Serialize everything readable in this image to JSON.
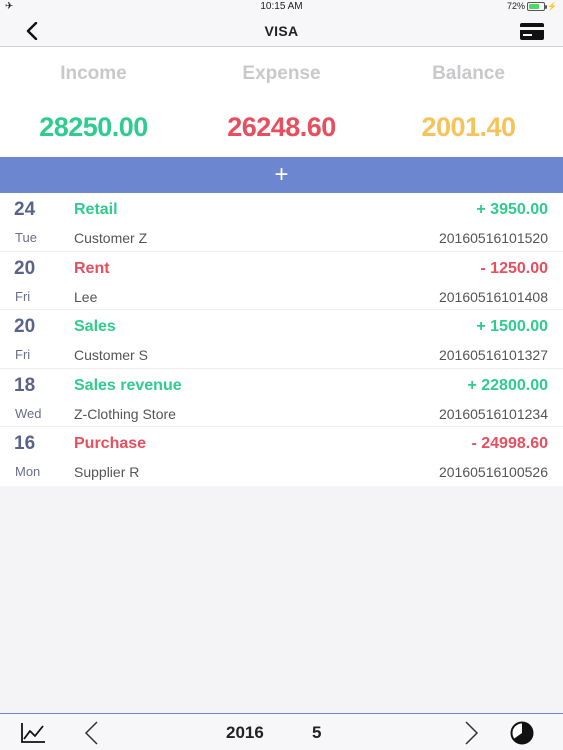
{
  "status_bar": {
    "time": "10:15 AM",
    "battery": "72%",
    "battery_level": 0.72
  },
  "nav": {
    "title": "VISA"
  },
  "summary": {
    "income_label": "Income",
    "expense_label": "Expense",
    "balance_label": "Balance",
    "income_value": "28250.00",
    "expense_value": "26248.60",
    "balance_value": "2001.40"
  },
  "add_bar": {
    "label": "+"
  },
  "transactions": [
    {
      "day": "24",
      "weekday": "Tue",
      "category": "Retail",
      "party": "Customer Z",
      "amount": "+ 3950.00",
      "id": "20160516101520",
      "type": "income"
    },
    {
      "day": "20",
      "weekday": "Fri",
      "category": "Rent",
      "party": "Lee",
      "amount": "- 1250.00",
      "id": "20160516101408",
      "type": "expense"
    },
    {
      "day": "20",
      "weekday": "Fri",
      "category": "Sales",
      "party": "Customer S",
      "amount": "+ 1500.00",
      "id": "20160516101327",
      "type": "income"
    },
    {
      "day": "18",
      "weekday": "Wed",
      "category": "Sales revenue",
      "party": "Z-Clothing Store",
      "amount": "+ 22800.00",
      "id": "20160516101234",
      "type": "income"
    },
    {
      "day": "16",
      "weekday": "Mon",
      "category": "Purchase",
      "party": "Supplier R",
      "amount": "- 24998.60",
      "id": "20160516100526",
      "type": "expense"
    }
  ],
  "toolbar": {
    "year": "2016",
    "month": "5"
  },
  "colors": {
    "income": "#2ecc8f",
    "expense": "#e84e5e",
    "balance": "#f5c35a",
    "accent": "#6d86d0"
  },
  "icons": {
    "status": [
      "airplane-icon",
      "battery-icon",
      "charging-icon"
    ],
    "nav": [
      "back-chevron-icon",
      "credit-card-icon"
    ],
    "toolbar": [
      "line-chart-icon",
      "chevron-left-icon",
      "chevron-right-icon",
      "pie-chart-icon"
    ]
  }
}
